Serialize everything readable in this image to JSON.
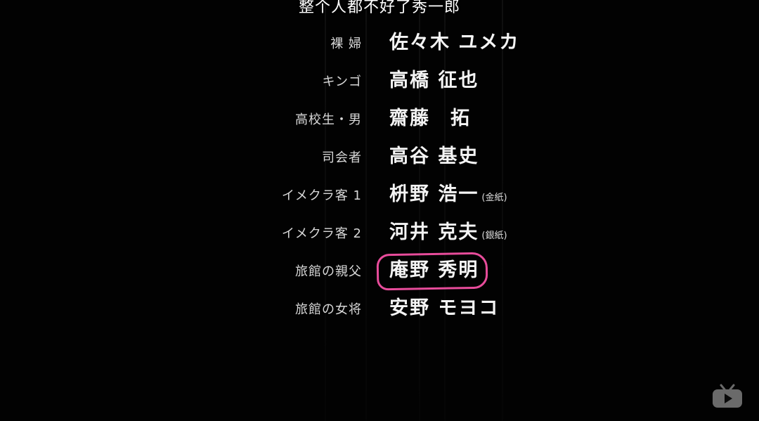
{
  "subtitle": "整个人都不好了秀一郎",
  "credits": [
    {
      "role": "裸 婦",
      "name": "佐々木 ユメカ",
      "note": ""
    },
    {
      "role": "キンゴ",
      "name": "高橋 征也",
      "note": ""
    },
    {
      "role": "高校生・男",
      "name": "齋藤　拓",
      "note": ""
    },
    {
      "role": "司会者",
      "name": "高谷 基史",
      "note": ""
    },
    {
      "role": "イメクラ客 1",
      "name": "枡野 浩一",
      "note": "(金紙)"
    },
    {
      "role": "イメクラ客 2",
      "name": "河井 克夫",
      "note": "(銀紙)"
    },
    {
      "role": "旅館の親父",
      "name": "庵野 秀明",
      "note": "",
      "highlighted": true
    },
    {
      "role": "旅館の女将",
      "name": "安野 モヨコ",
      "note": ""
    }
  ],
  "colors": {
    "background": "#000000",
    "highlight_circle": "#e84c9b",
    "logo": "#6a6a6a"
  },
  "icons": {
    "player_logo": "tv-play-icon"
  }
}
